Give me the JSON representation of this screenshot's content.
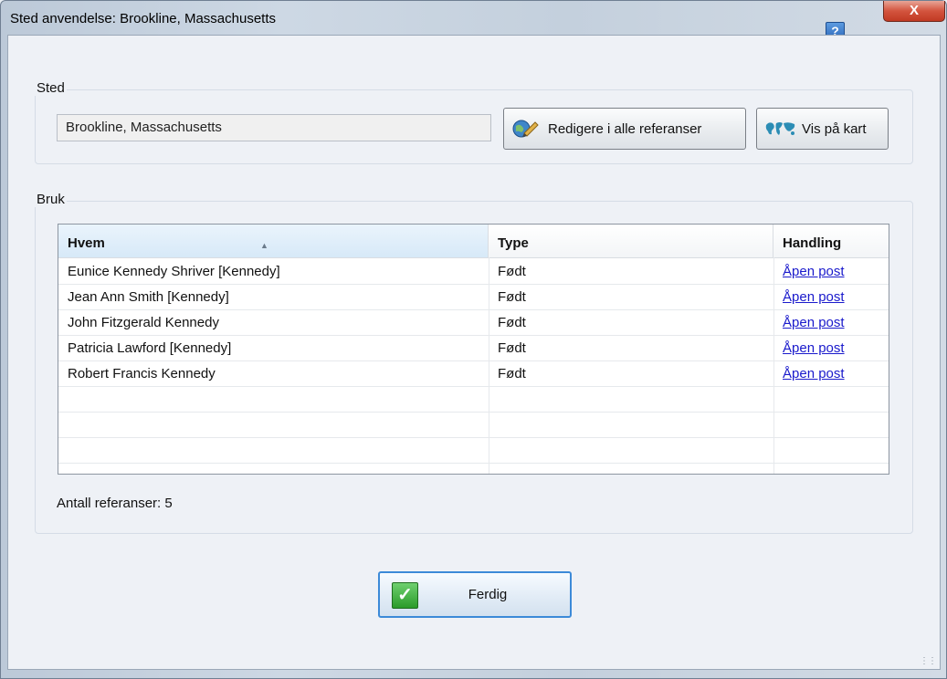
{
  "window": {
    "title": "Sted anvendelse: Brookline, Massachusetts",
    "help_label": "?",
    "close_label": "X"
  },
  "place_group": {
    "label": "Sted",
    "value": "Brookline, Massachusetts",
    "edit_button": "Redigere i alle referanser",
    "map_button": "Vis på kart"
  },
  "usage_group": {
    "label": "Bruk",
    "columns": [
      "Hvem",
      "Type",
      "Handling"
    ],
    "rows": [
      {
        "who": "Eunice Kennedy Shriver [Kennedy]",
        "type": "Født",
        "action": "Åpen post"
      },
      {
        "who": "Jean Ann Smith [Kennedy]",
        "type": "Født",
        "action": "Åpen post"
      },
      {
        "who": "John Fitzgerald Kennedy",
        "type": "Født",
        "action": "Åpen post"
      },
      {
        "who": "Patricia Lawford [Kennedy]",
        "type": "Født",
        "action": "Åpen post"
      },
      {
        "who": "Robert Francis Kennedy",
        "type": "Født",
        "action": "Åpen post"
      }
    ],
    "count_text": "Antall referanser: 5"
  },
  "footer": {
    "done_button": "Ferdig"
  },
  "icons": {
    "edit": "edit-globe-icon",
    "map": "world-map-icon",
    "done": "checkmark-icon",
    "help": "help-icon",
    "close": "close-icon"
  },
  "colors": {
    "link": "#1a1acc",
    "done_border": "#3c8ad8",
    "check_green": "#2b9b2b"
  }
}
